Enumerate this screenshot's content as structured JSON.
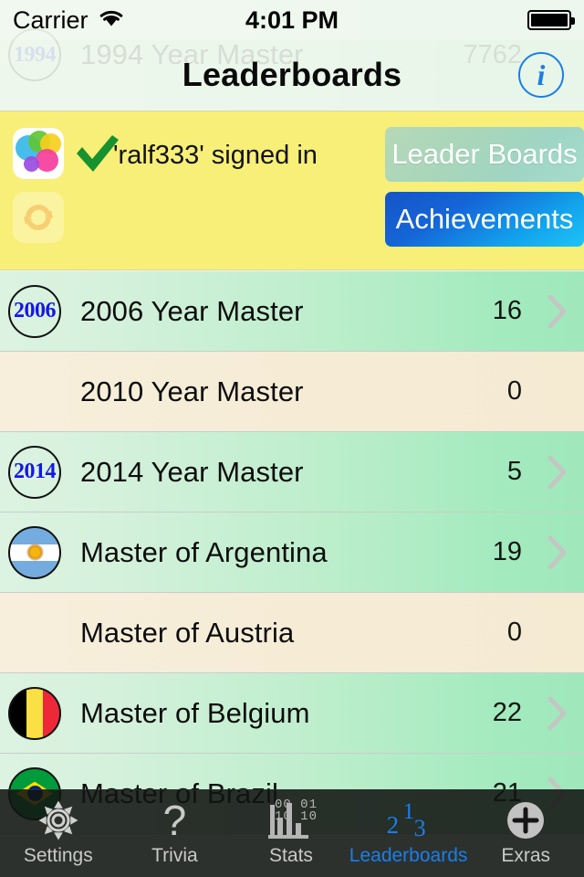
{
  "status_bar": {
    "carrier": "Carrier",
    "wifi_icon": "wifi-icon",
    "time": "4:01 PM",
    "battery_icon": "battery-full-icon"
  },
  "nav_bar": {
    "title": "Leaderboards",
    "info_label": "i"
  },
  "ghost_row": {
    "badge": "1994",
    "label": "1994 Year Master",
    "score": "7762"
  },
  "banner": {
    "game_center_icon": "game-center-icon",
    "check_icon": "green-check-icon",
    "signin_text": "'ralf333'  signed in",
    "refresh_icon": "refresh-sync-icon",
    "leaderboards_button": "Leader Boards",
    "achievements_button": "Achievements",
    "background_color": "#f8ef78",
    "achievements_color": "#1566d8"
  },
  "list": {
    "rows": [
      {
        "icon": "year-badge",
        "badge": "2006",
        "label": "2006 Year Master",
        "score": "16",
        "state": "green",
        "chevron": true
      },
      {
        "icon": "none",
        "badge": "",
        "label": "2010 Year Master",
        "score": "0",
        "state": "beige",
        "chevron": false
      },
      {
        "icon": "year-badge",
        "badge": "2014",
        "label": "2014 Year Master",
        "score": "5",
        "state": "green",
        "chevron": true
      },
      {
        "icon": "flag-ar",
        "badge": "",
        "label": "Master of Argentina",
        "score": "19",
        "state": "green",
        "chevron": true
      },
      {
        "icon": "none",
        "badge": "",
        "label": "Master of Austria",
        "score": "0",
        "state": "beige",
        "chevron": false
      },
      {
        "icon": "flag-be",
        "badge": "",
        "label": "Master of Belgium",
        "score": "22",
        "state": "green",
        "chevron": true
      },
      {
        "icon": "flag-br",
        "badge": "",
        "label": "Master of Brazil",
        "score": "21",
        "state": "green",
        "chevron": true
      }
    ]
  },
  "tab_bar": {
    "tabs": [
      {
        "label": "Settings",
        "icon": "gear-icon",
        "active": false
      },
      {
        "label": "Trivia",
        "icon": "question-icon",
        "active": false
      },
      {
        "label": "Stats",
        "icon": "bar-chart-icon",
        "active": false
      },
      {
        "label": "Leaderboards",
        "icon": "podium-123-icon",
        "active": true
      },
      {
        "label": "Exras",
        "icon": "plus-circle-icon",
        "active": false
      }
    ],
    "stats_binary_top": "00 01",
    "stats_binary_bottom": "10 10",
    "active_color": "#1a7ee8"
  }
}
